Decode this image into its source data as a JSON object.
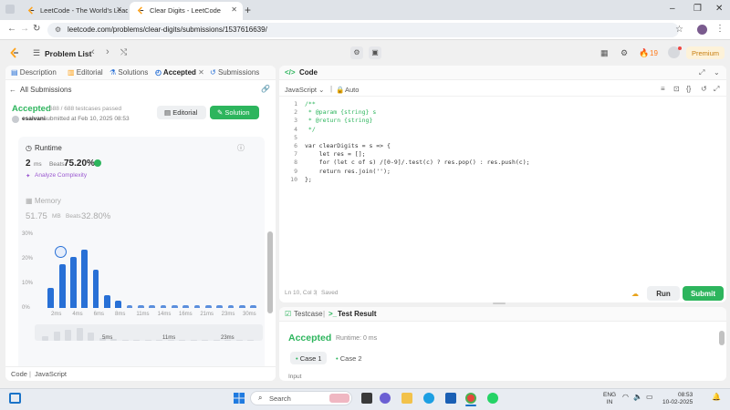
{
  "browser": {
    "tabs": [
      {
        "title": "LeetCode - The World's Leadin",
        "active": false
      },
      {
        "title": "Clear Digits - LeetCode",
        "active": true
      }
    ],
    "url": "leetcode.com/problems/clear-digits/submissions/1537616639/"
  },
  "header": {
    "problem_list": "Problem List",
    "streak": "19",
    "premium": "Premium"
  },
  "left": {
    "tabs": [
      "Description",
      "Editorial",
      "Solutions",
      "Accepted",
      "Submissions"
    ],
    "all_submissions": "All Submissions",
    "status": "Accepted",
    "testcases": "688 / 688 testcases passed",
    "user": "esaivani",
    "submitted": "submitted at Feb 10, 2025 08:53",
    "editorial_btn": "Editorial",
    "solution_btn": "Solution",
    "runtime_label": "Runtime",
    "runtime_value": "2",
    "runtime_unit": "ms",
    "beats_label": "Beats",
    "runtime_beats": "75.20%",
    "analyze": "Analyze Complexity",
    "memory_label": "Memory",
    "memory_value": "51.75",
    "memory_unit": "MB",
    "memory_beats": "32.80%",
    "footer_code": "Code",
    "footer_lang": "JavaScript"
  },
  "chart_data": {
    "type": "bar",
    "ylabels": [
      "30%",
      "20%",
      "10%",
      "0%"
    ],
    "ylim": [
      0,
      30
    ],
    "xlabels": [
      "2ms",
      "4ms",
      "6ms",
      "8ms",
      "11ms",
      "14ms",
      "16ms",
      "21ms",
      "23ms",
      "30ms"
    ],
    "values": [
      8,
      17,
      20,
      23,
      15,
      5,
      3,
      1,
      1,
      1,
      1,
      1,
      1,
      1,
      1,
      1,
      1,
      1,
      1
    ],
    "mini_labels": [
      "5ms",
      "11ms",
      "23ms"
    ]
  },
  "editor": {
    "title": "Code",
    "language": "JavaScript",
    "auto": "Auto",
    "lines": [
      "/**",
      " * @param {string} s",
      " * @return {string}",
      " */",
      "",
      "var clearDigits = s => {",
      "    let res = [];",
      "    for (let c of s) /[0-9]/.test(c) ? res.pop() : res.push(c);",
      "    return res.join('');",
      "};"
    ],
    "cursor": "Ln 10, Col 3",
    "saved": "Saved",
    "run": "Run",
    "submit": "Submit"
  },
  "result": {
    "tab_testcase": "Testcase",
    "tab_result": "Test Result",
    "status": "Accepted",
    "runtime": "Runtime: 0 ms",
    "case1": "Case 1",
    "case2": "Case 2",
    "input_label": "Input"
  },
  "taskbar": {
    "search": "Search",
    "lang1": "ENG",
    "lang2": "IN",
    "time": "08:53",
    "date": "10-02-2025"
  }
}
